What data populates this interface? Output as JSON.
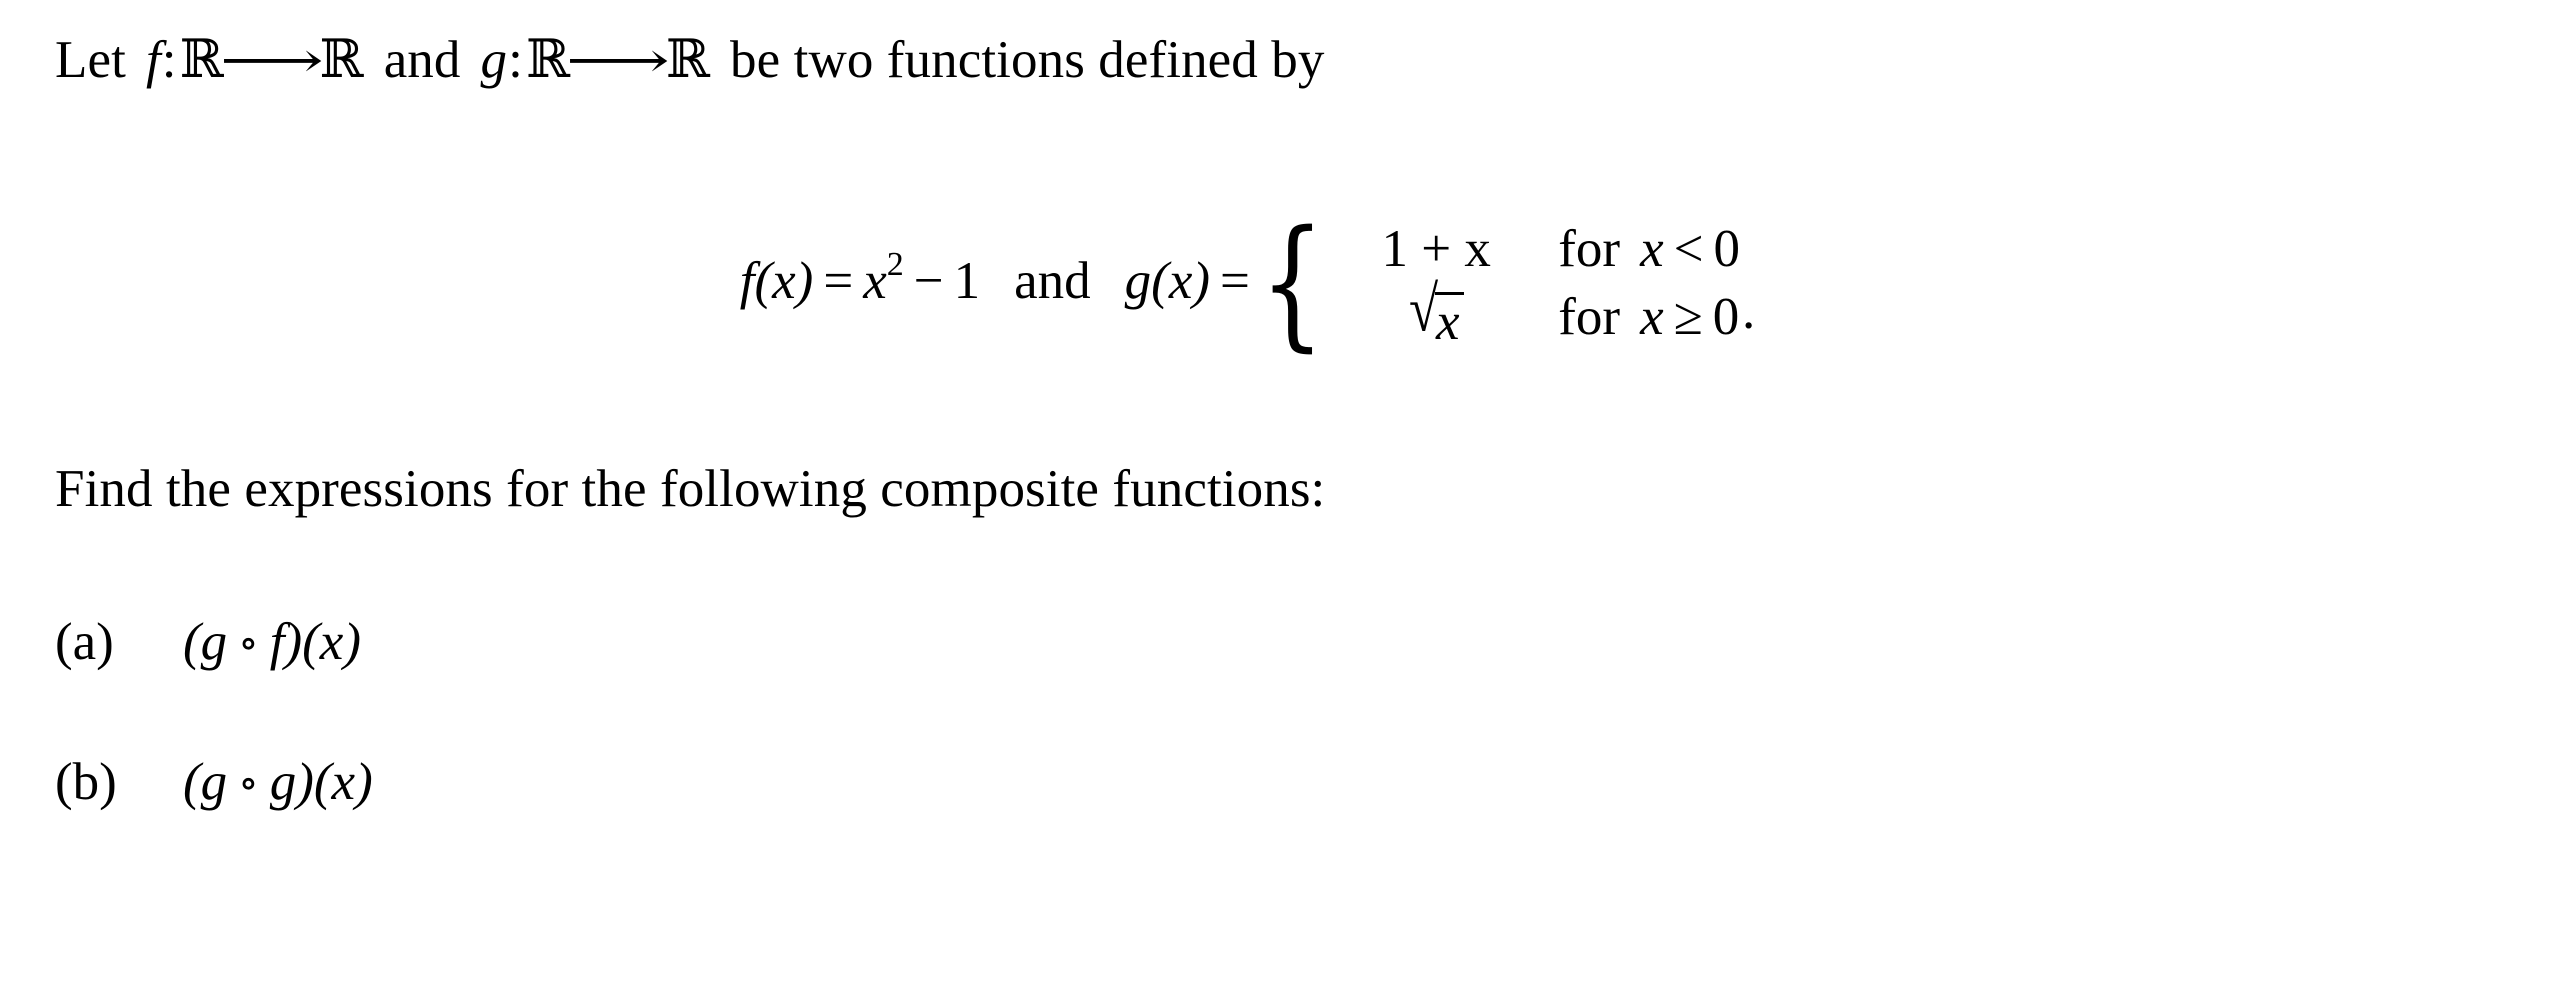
{
  "document": {
    "type": "math-problem",
    "background_color": "#ffffff",
    "text_color": "#000000"
  },
  "statement": {
    "lead": "Let",
    "f_symbol": "f",
    "g_symbol": "g",
    "colon": ":",
    "domain": "ℝ",
    "arrow": "⟶",
    "codomain": "ℝ",
    "conjunction": "and",
    "tail": "be two functions defined by"
  },
  "equation": {
    "f_name": "f",
    "f_arg": "(x)",
    "f_equals": "=",
    "f_base": "x",
    "f_exponent": "2",
    "f_minus": "−",
    "f_constant": "1",
    "conjunction": "and",
    "g_name": "g",
    "g_arg": "(x)",
    "g_equals": "=",
    "brace": "{",
    "cases": [
      {
        "value": "1 + x",
        "condition_word": "for",
        "condition": "x < 0"
      },
      {
        "value": "√x",
        "condition_word": "for",
        "condition": "x ≥ 0"
      }
    ],
    "case_1_value_text": "1 + x",
    "case_2_radical": "√",
    "case_2_radicand": "x",
    "case_1_condition_var": "x",
    "case_1_condition_rel": "<",
    "case_1_condition_num": "0",
    "case_2_condition_var": "x",
    "case_2_condition_rel": "≥",
    "case_2_condition_num": "0",
    "terminator": "."
  },
  "instruction": {
    "text": "Find the expressions for the following composite functions:"
  },
  "items": [
    {
      "label": "(a)",
      "open_paren": "(",
      "left_fn": "g",
      "compose": "∘",
      "right_fn": "f",
      "close_paren": ")",
      "argument": "(x)",
      "expression": "(g ∘ f)(x)"
    },
    {
      "label": "(b)",
      "open_paren": "(",
      "left_fn": "g",
      "compose": "∘",
      "right_fn": "g",
      "close_paren": ")",
      "argument": "(x)",
      "expression": "(g ∘ g)(x)"
    }
  ]
}
